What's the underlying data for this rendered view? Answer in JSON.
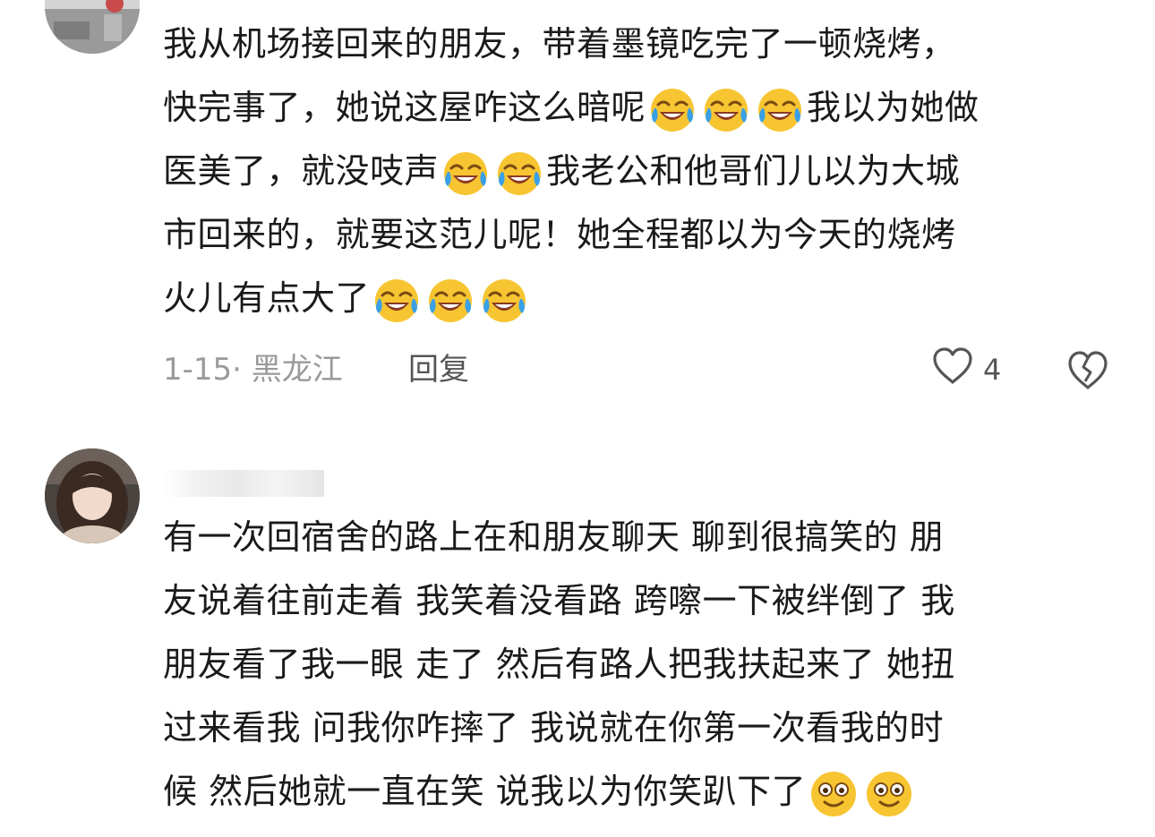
{
  "comments": [
    {
      "lines": [
        [
          "我从机场接回来的朋友，带着墨镜吃完了一顿烧烤，"
        ],
        [
          "快完事了，她说这屋咋这么暗呢",
          "[laugh-cry]",
          "[laugh-cry]",
          "[laugh-cry]",
          "我以为她做"
        ],
        [
          "医美了，就没吱声",
          "[laugh-cry]",
          "[laugh-cry]",
          "我老公和他哥们儿以为大城"
        ],
        [
          "市回来的，就要这范儿呢！她全程都以为今天的烧烤"
        ],
        [
          "火儿有点大了",
          "[laugh-cry]",
          "[laugh-cry]",
          "[laugh-cry]"
        ]
      ],
      "date_location": "1-15· 黑龙江",
      "reply_label": "回复",
      "like_count": "4"
    },
    {
      "lines": [
        [
          "有一次回宿舍的路上在和朋友聊天 聊到很搞笑的 朋"
        ],
        [
          "友说着往前走着 我笑着没看路 跨嚓一下被绊倒了 我"
        ],
        [
          "朋友看了我一眼 走了 然后有路人把我扶起来了 她扭"
        ],
        [
          "过来看我 问我你咋摔了 我说就在你第一次看我的时"
        ],
        [
          "候 然后她就一直在笑 说我以为你笑趴下了",
          "[wide-eyed-smile]",
          "[wide-eyed-smile]"
        ]
      ]
    }
  ],
  "icons": {
    "laugh-cry": "laugh-cry-emoji-icon",
    "wide-eyed-smile": "wide-eyed-smile-emoji-icon",
    "like": "heart-outline-icon",
    "dislike": "broken-heart-icon"
  },
  "colors": {
    "text": "#1a1a1a",
    "meta": "#9a9a9a",
    "reply": "#555555",
    "emoji_yellow": "#f7c531"
  }
}
